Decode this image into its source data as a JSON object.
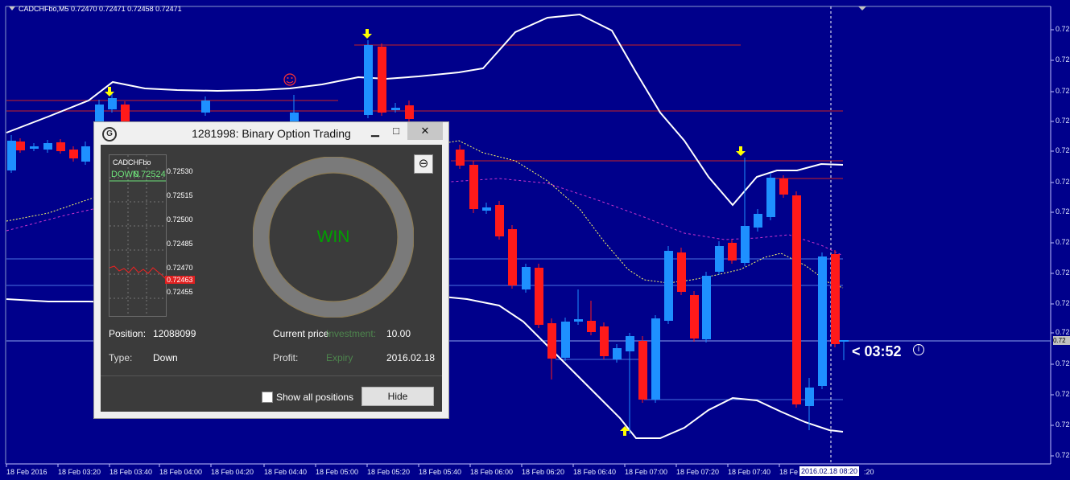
{
  "chart": {
    "symbol_label": "CADCHFbo,M5  0.72470 0.72471 0.72458 0.72471",
    "colors": {
      "background": "#00008B",
      "bull": "#1E90FF",
      "bear": "#FF1A1A",
      "band": "#FFFFFF",
      "ma_yellow": "#FFFF66",
      "ma_magenta": "#CC33CC",
      "level_red": "#CC2222",
      "level_blue": "#4A72E0",
      "arrow": "#FFFF00"
    },
    "price_axis_labels": [
      "0.72",
      "0.72",
      "0.72",
      "0.72",
      "0.72",
      "0.72",
      "0.72",
      "0.72",
      "0.72",
      "0.72",
      "0.72",
      "0.72",
      "0.72",
      "0.72",
      "0.72"
    ],
    "current_price_tag": "0.72",
    "time_axis_labels": [
      "18 Feb 2016",
      "18 Feb 03:20",
      "18 Feb 03:40",
      "18 Feb 04:00",
      "18 Feb 04:20",
      "18 Feb 04:40",
      "18 Feb 05:00",
      "18 Feb 05:20",
      "18 Feb 05:40",
      "18 Feb 06:00",
      "18 Feb 06:20",
      "18 Feb 06:40",
      "18 Feb 07:00",
      "18 Feb 07:20",
      "18 Feb 07:40",
      "18 Fe"
    ],
    "time_axis_tail": ":20",
    "crosshair_time": "2016.02.18 08:20",
    "countdown": "< 03:52",
    "info_icon": "info-icon",
    "smiley_icon": "smiley-icon"
  },
  "dialog": {
    "title": "1281998: Binary Option Trading",
    "icon_letter": "G",
    "minimize": "▁",
    "maximize": "□",
    "close": "✕",
    "back_icon": "back-arrow-icon",
    "back_glyph": "⊖",
    "mini_chart": {
      "symbol": "CADCHFbo",
      "direction": "DOWN",
      "open_price": "0.72524",
      "price_labels": [
        "0.72530",
        "0.72515",
        "0.72500",
        "0.72485",
        "0.72470",
        "0.72455"
      ],
      "current_price": "0.72463"
    },
    "result": "WIN",
    "fields": {
      "position_label": "Position:",
      "position_value": "12088099",
      "type_label": "Type:",
      "type_value": "Down",
      "current_price_label": "Current price",
      "investment_label": "Investment:",
      "investment_value": "10.00",
      "profit_label": "Profit:",
      "expiry_label": "Expiry",
      "expiry_value": "2016.02.18"
    },
    "show_all_label": "Show all positions",
    "hide_label": "Hide"
  }
}
